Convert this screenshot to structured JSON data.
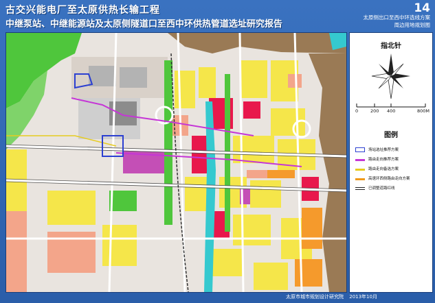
{
  "header": {
    "title": "古交兴能电厂至太原供热长输工程",
    "subtitle": "中继泵站、中继能源站及太原侧隧道口至西中环供热管道选址研究报告"
  },
  "sheet": {
    "number": "14",
    "name_line1": "太原侧出口至西中环选线方案",
    "name_line2": "周边用地规划图"
  },
  "north": {
    "title": "指北针",
    "scale_labels": [
      "0",
      "200",
      "400",
      "800M"
    ]
  },
  "legend": {
    "title": "图例",
    "items": [
      {
        "label": "场站选址推荐方案",
        "color": "#2b3fd1",
        "kind": "outline"
      },
      {
        "label": "路由走向推荐方案",
        "color": "#c536d6",
        "kind": "line"
      },
      {
        "label": "路由走向备选方案",
        "color": "#e6cc1f",
        "kind": "line"
      },
      {
        "label": "高速环西侧路由走向方案",
        "color": "#f09a1a",
        "kind": "line"
      },
      {
        "label": "已调整道路红线",
        "color": "#222222",
        "kind": "line"
      }
    ]
  },
  "footer": {
    "org": "太原市城市规划设计研究院",
    "date": "2013年10月"
  },
  "colors": {
    "residential": "#f5e64a",
    "commercial": "#e8184c",
    "education": "#f3a58a",
    "green": "#4fc63c",
    "industrial": "#9a7a55",
    "water": "#35c9cf",
    "admin": "#c44fb6",
    "grey": "#b3b3b3",
    "orange": "#f59a2c",
    "route_recommended": "#c536d6",
    "route_station": "#2b3fd1"
  }
}
